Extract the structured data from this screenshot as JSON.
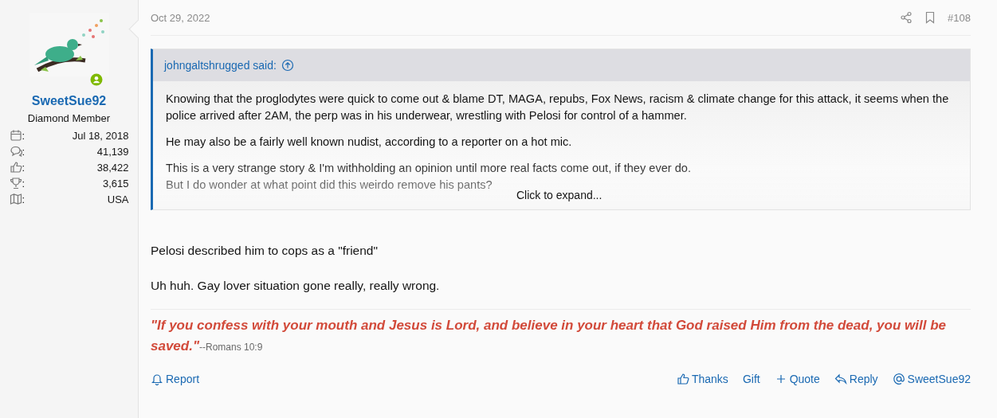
{
  "author": {
    "username": "SweetSue92",
    "online": true,
    "title": "Diamond Member",
    "stats": [
      {
        "kind": "joined",
        "label": ":",
        "value": "Jul 18, 2018"
      },
      {
        "kind": "messages",
        "label": ":",
        "value": "41,139"
      },
      {
        "kind": "reactions",
        "label": ":",
        "value": "38,422"
      },
      {
        "kind": "points",
        "label": ":",
        "value": "3,615"
      },
      {
        "kind": "location",
        "label": ":",
        "value": "USA"
      }
    ]
  },
  "post": {
    "date": "Oct 29, 2022",
    "number": "#108",
    "quote": {
      "attribution": "johngaltshrugged said:",
      "collapsed": true,
      "expand": "Click to expand...",
      "paragraphs": [
        "Knowing that the proglodytes were quick to come out & blame DT, MAGA, repubs, Fox News, racism & climate change for this attack, it seems when the police arrived after 2AM, the perp was in his underwear, wrestling with Pelosi for control of a hammer.",
        "He may also be a fairly well known nudist, according to a reporter on a hot mic.",
        "This is a very strange story & I'm withholding an opinion until more real facts come out, if they ever do.\nBut I do wonder at what point did this weirdo remove his pants?"
      ]
    },
    "body": [
      "Pelosi described him to cops as a \"friend\"",
      "Uh huh. Gay lover situation gone really, really wrong."
    ],
    "signature": {
      "quote": "\"If you confess with your mouth and Jesus is Lord, and believe in your heart that God raised Him from the dead, you will be saved.\"",
      "source": "--Romans 10:9"
    },
    "actions_left": [
      {
        "kind": "report",
        "label": "Report"
      }
    ],
    "actions_right": [
      {
        "kind": "thanks",
        "label": "Thanks"
      },
      {
        "kind": "gift",
        "label": "Gift"
      },
      {
        "kind": "quote",
        "label": "Quote"
      },
      {
        "kind": "reply",
        "label": "Reply"
      },
      {
        "kind": "mention",
        "label": "SweetSue92"
      }
    ]
  }
}
